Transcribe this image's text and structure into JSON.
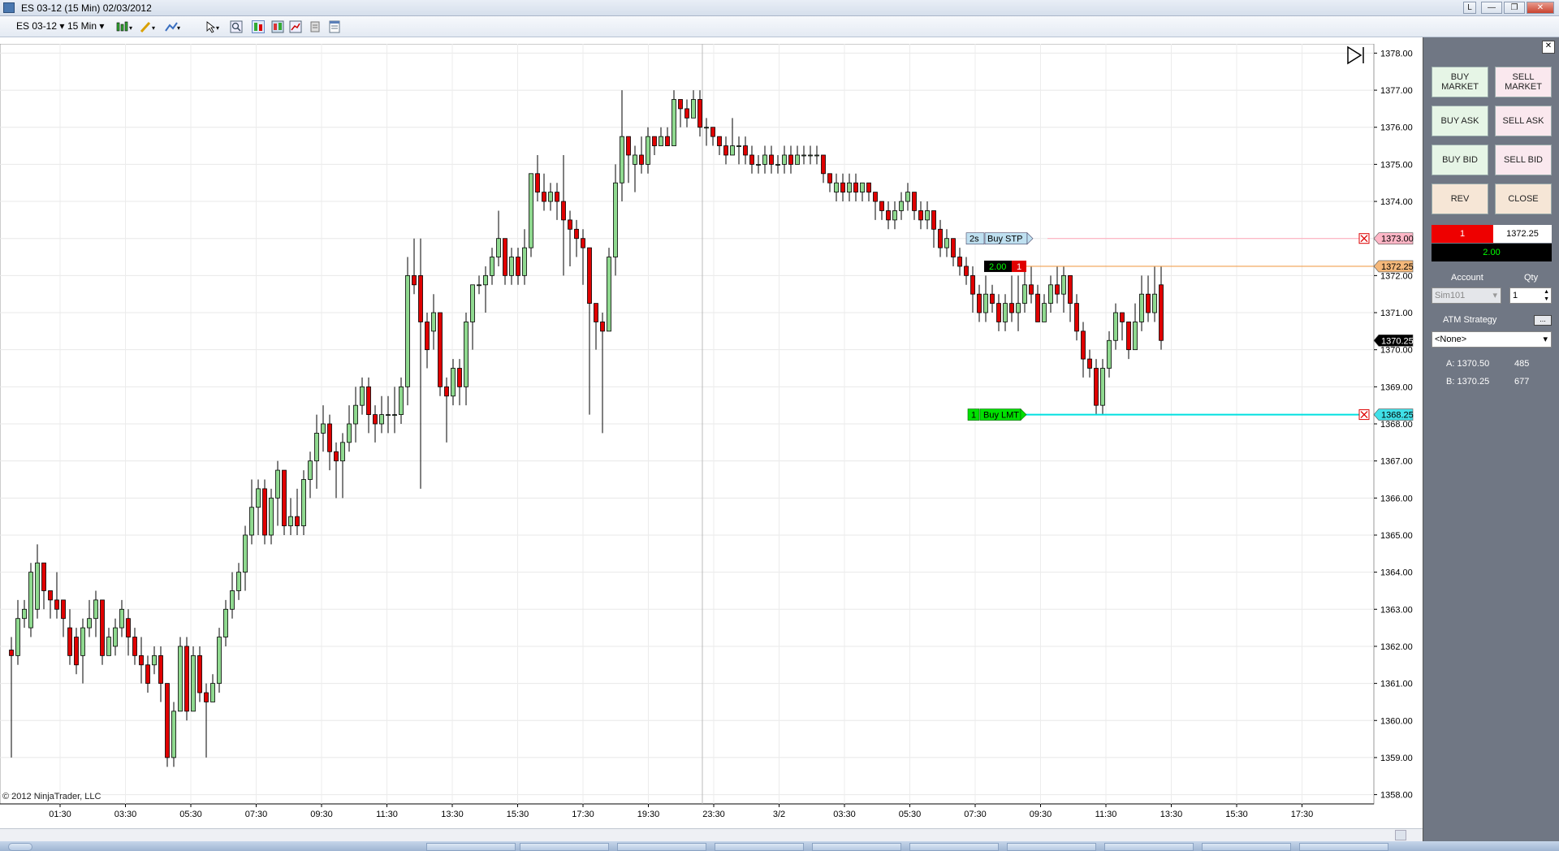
{
  "window": {
    "title": "ES 03-12 (15 Min)  02/03/2012",
    "buttons": [
      "L",
      "—",
      "❐",
      "✕"
    ]
  },
  "toolbar": {
    "instrument": "ES 03-12",
    "interval": "15 Min"
  },
  "chart_data": {
    "type": "candlestick",
    "instrument": "ES 03-12",
    "interval": "15 Min",
    "ylim": [
      1357.75,
      1378.25
    ],
    "y_ticks": [
      "1378.00",
      "1377.00",
      "1376.00",
      "1375.00",
      "1374.00",
      "1373.00",
      "1372.00",
      "1371.00",
      "1370.00",
      "1369.00",
      "1368.00",
      "1367.00",
      "1366.00",
      "1365.00",
      "1364.00",
      "1363.00",
      "1362.00",
      "1361.00",
      "1360.00",
      "1359.00",
      "1358.00"
    ],
    "x_ticks": [
      "01:30",
      "03:30",
      "05:30",
      "07:30",
      "09:30",
      "11:30",
      "13:30",
      "15:30",
      "17:30",
      "19:30",
      "23:30",
      "3/2",
      "03:30",
      "05:30",
      "07:30",
      "09:30",
      "11:30",
      "13:30",
      "15:30",
      "17:30"
    ],
    "colors": {
      "up": "#8fd98f",
      "down": "#e00000",
      "outline": "#000000"
    },
    "candles": [
      [
        1361.9,
        1361.75,
        1362.25,
        1359.0
      ],
      [
        1361.75,
        1362.75,
        1363.25,
        1361.5
      ],
      [
        1362.75,
        1363.0,
        1363.25,
        1362.5
      ],
      [
        1362.5,
        1364.0,
        1364.25,
        1362.25
      ],
      [
        1363.0,
        1364.25,
        1364.75,
        1362.75
      ],
      [
        1364.25,
        1363.5,
        1364.25,
        1363.0
      ],
      [
        1363.5,
        1363.25,
        1363.5,
        1362.75
      ],
      [
        1363.25,
        1363.0,
        1364.0,
        1362.75
      ],
      [
        1363.25,
        1362.75,
        1363.25,
        1362.25
      ],
      [
        1362.5,
        1361.75,
        1363.0,
        1361.5
      ],
      [
        1362.25,
        1361.5,
        1362.5,
        1361.25
      ],
      [
        1361.75,
        1362.5,
        1362.75,
        1361.0
      ],
      [
        1362.5,
        1362.75,
        1363.25,
        1362.25
      ],
      [
        1362.75,
        1363.25,
        1363.5,
        1362.25
      ],
      [
        1363.25,
        1361.75,
        1363.25,
        1361.5
      ],
      [
        1361.75,
        1362.25,
        1362.5,
        1361.75
      ],
      [
        1362.0,
        1362.5,
        1362.75,
        1361.75
      ],
      [
        1362.5,
        1363.0,
        1363.25,
        1362.25
      ],
      [
        1362.75,
        1362.25,
        1363.0,
        1361.75
      ],
      [
        1362.25,
        1361.75,
        1362.5,
        1361.5
      ],
      [
        1361.75,
        1361.5,
        1362.25,
        1361.0
      ],
      [
        1361.5,
        1361.0,
        1361.75,
        1360.75
      ],
      [
        1361.5,
        1361.75,
        1362.0,
        1361.25
      ],
      [
        1361.75,
        1361.0,
        1362.0,
        1360.5
      ],
      [
        1361.0,
        1359.0,
        1361.0,
        1358.75
      ],
      [
        1359.0,
        1360.25,
        1360.5,
        1358.75
      ],
      [
        1360.25,
        1362.0,
        1362.25,
        1360.25
      ],
      [
        1362.0,
        1360.25,
        1362.25,
        1360.0
      ],
      [
        1360.25,
        1361.75,
        1362.0,
        1360.25
      ],
      [
        1361.75,
        1360.75,
        1362.0,
        1360.5
      ],
      [
        1360.75,
        1360.5,
        1361.0,
        1359.0
      ],
      [
        1360.5,
        1361.0,
        1361.25,
        1360.5
      ],
      [
        1361.0,
        1362.25,
        1362.5,
        1360.75
      ],
      [
        1362.25,
        1363.0,
        1363.25,
        1362.0
      ],
      [
        1363.0,
        1363.5,
        1364.0,
        1362.75
      ],
      [
        1363.5,
        1364.0,
        1364.25,
        1363.25
      ],
      [
        1364.0,
        1365.0,
        1365.25,
        1363.5
      ],
      [
        1365.0,
        1365.75,
        1366.5,
        1364.75
      ],
      [
        1365.75,
        1366.25,
        1366.5,
        1365.0
      ],
      [
        1366.25,
        1365.0,
        1366.5,
        1364.75
      ],
      [
        1365.0,
        1366.0,
        1366.25,
        1364.75
      ],
      [
        1366.0,
        1366.75,
        1367.0,
        1365.25
      ],
      [
        1366.75,
        1365.25,
        1366.75,
        1365.0
      ],
      [
        1365.25,
        1365.5,
        1366.0,
        1365.0
      ],
      [
        1365.5,
        1365.25,
        1366.25,
        1365.0
      ],
      [
        1365.25,
        1366.5,
        1366.75,
        1365.0
      ],
      [
        1366.5,
        1367.0,
        1367.25,
        1366.0
      ],
      [
        1367.0,
        1367.75,
        1368.25,
        1366.25
      ],
      [
        1367.75,
        1368.0,
        1368.5,
        1367.25
      ],
      [
        1368.0,
        1367.25,
        1368.25,
        1366.75
      ],
      [
        1367.25,
        1367.0,
        1367.5,
        1366.0
      ],
      [
        1367.0,
        1367.5,
        1367.75,
        1366.0
      ],
      [
        1367.5,
        1368.0,
        1368.5,
        1367.25
      ],
      [
        1368.0,
        1368.5,
        1369.0,
        1367.5
      ],
      [
        1368.5,
        1369.0,
        1369.25,
        1368.25
      ],
      [
        1369.0,
        1368.25,
        1369.25,
        1367.75
      ],
      [
        1368.25,
        1368.0,
        1368.5,
        1367.5
      ],
      [
        1368.0,
        1368.25,
        1368.75,
        1367.75
      ],
      [
        1368.25,
        1368.25,
        1368.75,
        1367.75
      ],
      [
        1368.25,
        1368.25,
        1369.0,
        1367.75
      ],
      [
        1368.25,
        1369.0,
        1369.25,
        1368.0
      ],
      [
        1369.0,
        1372.0,
        1372.5,
        1368.5
      ],
      [
        1372.0,
        1371.75,
        1373.0,
        1371.5
      ],
      [
        1372.0,
        1370.75,
        1373.0,
        1366.25
      ],
      [
        1370.75,
        1370.0,
        1371.0,
        1369.5
      ],
      [
        1370.5,
        1371.0,
        1371.5,
        1370.0
      ],
      [
        1371.0,
        1369.0,
        1371.0,
        1368.75
      ],
      [
        1369.0,
        1368.75,
        1369.25,
        1367.5
      ],
      [
        1368.75,
        1369.5,
        1369.75,
        1368.5
      ],
      [
        1369.5,
        1369.0,
        1369.75,
        1368.5
      ],
      [
        1369.0,
        1370.75,
        1371.0,
        1368.5
      ],
      [
        1370.75,
        1371.75,
        1371.75,
        1370.0
      ],
      [
        1371.75,
        1371.75,
        1372.0,
        1371.5
      ],
      [
        1371.75,
        1372.0,
        1372.25,
        1371.0
      ],
      [
        1372.0,
        1372.5,
        1372.75,
        1371.75
      ],
      [
        1372.5,
        1373.0,
        1373.75,
        1372.25
      ],
      [
        1373.0,
        1372.0,
        1373.0,
        1371.75
      ],
      [
        1372.0,
        1372.5,
        1372.75,
        1371.75
      ],
      [
        1372.5,
        1372.0,
        1372.75,
        1371.75
      ],
      [
        1372.0,
        1372.75,
        1373.25,
        1371.75
      ],
      [
        1372.75,
        1374.75,
        1374.75,
        1372.5
      ],
      [
        1374.75,
        1374.25,
        1375.25,
        1374.0
      ],
      [
        1374.25,
        1374.0,
        1374.75,
        1373.75
      ],
      [
        1374.0,
        1374.25,
        1374.5,
        1373.75
      ],
      [
        1374.25,
        1374.0,
        1374.5,
        1373.5
      ],
      [
        1374.0,
        1373.5,
        1375.25,
        1372.0
      ],
      [
        1373.5,
        1373.25,
        1373.75,
        1372.25
      ],
      [
        1373.25,
        1373.0,
        1373.5,
        1372.5
      ],
      [
        1373.0,
        1372.75,
        1373.25,
        1371.75
      ],
      [
        1372.75,
        1371.25,
        1372.75,
        1368.25
      ],
      [
        1371.25,
        1370.75,
        1371.25,
        1370.0
      ],
      [
        1370.75,
        1370.5,
        1371.0,
        1367.75
      ],
      [
        1370.5,
        1372.5,
        1372.75,
        1370.5
      ],
      [
        1372.5,
        1374.5,
        1375.0,
        1372.0
      ],
      [
        1374.5,
        1375.75,
        1377.0,
        1374.0
      ],
      [
        1375.75,
        1375.25,
        1375.75,
        1374.5
      ],
      [
        1375.0,
        1375.25,
        1375.5,
        1374.25
      ],
      [
        1375.25,
        1375.0,
        1375.75,
        1374.75
      ],
      [
        1375.0,
        1375.75,
        1376.0,
        1374.75
      ],
      [
        1375.75,
        1375.5,
        1375.75,
        1375.25
      ],
      [
        1375.5,
        1375.75,
        1376.0,
        1375.5
      ],
      [
        1375.75,
        1375.5,
        1376.0,
        1375.5
      ],
      [
        1375.5,
        1376.75,
        1377.0,
        1375.5
      ],
      [
        1376.75,
        1376.5,
        1376.75,
        1376.0
      ],
      [
        1376.5,
        1376.25,
        1376.75,
        1376.0
      ],
      [
        1376.25,
        1376.75,
        1377.0,
        1376.25
      ],
      [
        1376.75,
        1376.0,
        1377.0,
        1375.75
      ],
      [
        1376.0,
        1376.0,
        1376.25,
        1375.5
      ],
      [
        1376.0,
        1375.75,
        1376.0,
        1375.5
      ],
      [
        1375.75,
        1375.5,
        1375.75,
        1375.25
      ],
      [
        1375.5,
        1375.25,
        1375.75,
        1375.0
      ],
      [
        1375.25,
        1375.5,
        1376.25,
        1375.25
      ],
      [
        1375.5,
        1375.5,
        1375.75,
        1375.0
      ],
      [
        1375.5,
        1375.25,
        1375.75,
        1375.0
      ],
      [
        1375.25,
        1375.0,
        1375.5,
        1374.75
      ],
      [
        1375.0,
        1375.0,
        1375.25,
        1374.75
      ],
      [
        1375.0,
        1375.25,
        1375.5,
        1374.75
      ],
      [
        1375.25,
        1375.0,
        1375.5,
        1374.75
      ],
      [
        1375.0,
        1375.0,
        1375.25,
        1374.75
      ],
      [
        1375.0,
        1375.25,
        1375.5,
        1374.75
      ],
      [
        1375.25,
        1375.0,
        1375.5,
        1374.75
      ],
      [
        1375.0,
        1375.25,
        1375.5,
        1375.0
      ],
      [
        1375.25,
        1375.25,
        1375.5,
        1375.0
      ],
      [
        1375.25,
        1375.25,
        1375.5,
        1375.0
      ],
      [
        1375.25,
        1375.25,
        1375.5,
        1375.0
      ],
      [
        1375.25,
        1374.75,
        1375.25,
        1374.5
      ],
      [
        1374.75,
        1374.5,
        1374.75,
        1374.25
      ],
      [
        1374.25,
        1374.5,
        1374.75,
        1374.0
      ],
      [
        1374.5,
        1374.25,
        1374.75,
        1374.0
      ],
      [
        1374.25,
        1374.5,
        1374.75,
        1374.0
      ],
      [
        1374.5,
        1374.25,
        1374.75,
        1374.0
      ],
      [
        1374.25,
        1374.5,
        1374.5,
        1374.0
      ],
      [
        1374.5,
        1374.25,
        1374.5,
        1374.0
      ],
      [
        1374.25,
        1374.0,
        1374.25,
        1373.5
      ],
      [
        1374.0,
        1373.75,
        1374.0,
        1373.5
      ],
      [
        1373.75,
        1373.5,
        1374.0,
        1373.25
      ],
      [
        1373.5,
        1373.75,
        1374.0,
        1373.25
      ],
      [
        1373.75,
        1374.0,
        1374.25,
        1373.5
      ],
      [
        1374.0,
        1374.25,
        1374.5,
        1373.75
      ],
      [
        1374.25,
        1373.75,
        1374.25,
        1373.5
      ],
      [
        1373.75,
        1373.5,
        1374.0,
        1373.25
      ],
      [
        1373.5,
        1373.75,
        1374.0,
        1373.25
      ],
      [
        1373.75,
        1373.25,
        1373.75,
        1372.75
      ],
      [
        1373.25,
        1372.75,
        1373.5,
        1372.5
      ],
      [
        1372.75,
        1373.0,
        1373.25,
        1372.5
      ],
      [
        1373.0,
        1372.5,
        1373.0,
        1372.25
      ],
      [
        1372.5,
        1372.25,
        1372.75,
        1372.0
      ],
      [
        1372.25,
        1372.0,
        1372.5,
        1371.75
      ],
      [
        1372.0,
        1371.5,
        1372.25,
        1371.0
      ],
      [
        1371.5,
        1371.0,
        1371.75,
        1370.75
      ],
      [
        1371.0,
        1371.5,
        1372.0,
        1370.75
      ],
      [
        1371.5,
        1371.25,
        1371.75,
        1371.0
      ],
      [
        1371.25,
        1370.75,
        1371.5,
        1370.5
      ],
      [
        1370.75,
        1371.25,
        1371.5,
        1370.5
      ],
      [
        1371.25,
        1371.0,
        1372.0,
        1370.75
      ],
      [
        1371.0,
        1371.25,
        1372.0,
        1370.5
      ],
      [
        1371.25,
        1371.75,
        1372.25,
        1371.0
      ],
      [
        1371.75,
        1371.5,
        1372.25,
        1371.25
      ],
      [
        1371.5,
        1370.75,
        1371.75,
        1370.75
      ],
      [
        1370.75,
        1371.25,
        1371.5,
        1370.75
      ],
      [
        1371.25,
        1371.75,
        1372.0,
        1371.0
      ],
      [
        1371.75,
        1371.5,
        1372.25,
        1371.25
      ],
      [
        1371.5,
        1372.0,
        1372.25,
        1371.0
      ],
      [
        1372.0,
        1371.25,
        1372.0,
        1370.75
      ],
      [
        1371.25,
        1370.5,
        1371.5,
        1370.25
      ],
      [
        1370.5,
        1369.75,
        1370.75,
        1369.25
      ],
      [
        1369.75,
        1369.5,
        1370.0,
        1369.25
      ],
      [
        1369.5,
        1368.5,
        1369.75,
        1368.25
      ],
      [
        1368.5,
        1369.5,
        1369.75,
        1368.25
      ],
      [
        1369.5,
        1370.25,
        1370.5,
        1369.25
      ],
      [
        1370.25,
        1371.0,
        1371.25,
        1370.0
      ],
      [
        1371.0,
        1370.75,
        1371.0,
        1370.25
      ],
      [
        1370.75,
        1370.0,
        1370.75,
        1369.75
      ],
      [
        1370.0,
        1370.75,
        1371.25,
        1370.0
      ],
      [
        1370.75,
        1371.5,
        1372.0,
        1370.5
      ],
      [
        1371.5,
        1371.0,
        1372.0,
        1370.75
      ],
      [
        1371.0,
        1371.5,
        1372.25,
        1370.75
      ],
      [
        1371.75,
        1370.25,
        1372.25,
        1370.0
      ]
    ],
    "orders": [
      {
        "label": "Buy STP",
        "qty_tag": "2s",
        "price": 1373.0,
        "price_label": "1373.00",
        "line_color": "#ffb0c0"
      },
      {
        "label": "Buy LMT",
        "qty_tag": "1",
        "price": 1368.25,
        "price_label": "1368.25",
        "line_color": "#00e0e0"
      }
    ],
    "position": {
      "price": 1372.25,
      "price_label": "1372.25",
      "pnl_label": "2.00",
      "qty_label": "1",
      "line_color": "#f0a050"
    },
    "last_price": {
      "price": 1370.25,
      "price_label": "1370.25"
    },
    "copyright": "© 2012 NinjaTrader, LLC"
  },
  "side_panel": {
    "buy_market": "BUY\nMARKET",
    "sell_market": "SELL\nMARKET",
    "buy_ask": "BUY ASK",
    "sell_ask": "SELL ASK",
    "buy_bid": "BUY BID",
    "sell_bid": "SELL BID",
    "rev": "REV",
    "close": "CLOSE",
    "position_qty": "1",
    "position_price": "1372.25",
    "position_pnl": "2.00",
    "account_label": "Account",
    "qty_label": "Qty",
    "account_value": "Sim101",
    "qty_value": "1",
    "atm_label": "ATM Strategy",
    "atm_value": "<None>",
    "ask_label": "A: 1370.50",
    "ask_size": "485",
    "bid_label": "B: 1370.25",
    "bid_size": "677"
  }
}
